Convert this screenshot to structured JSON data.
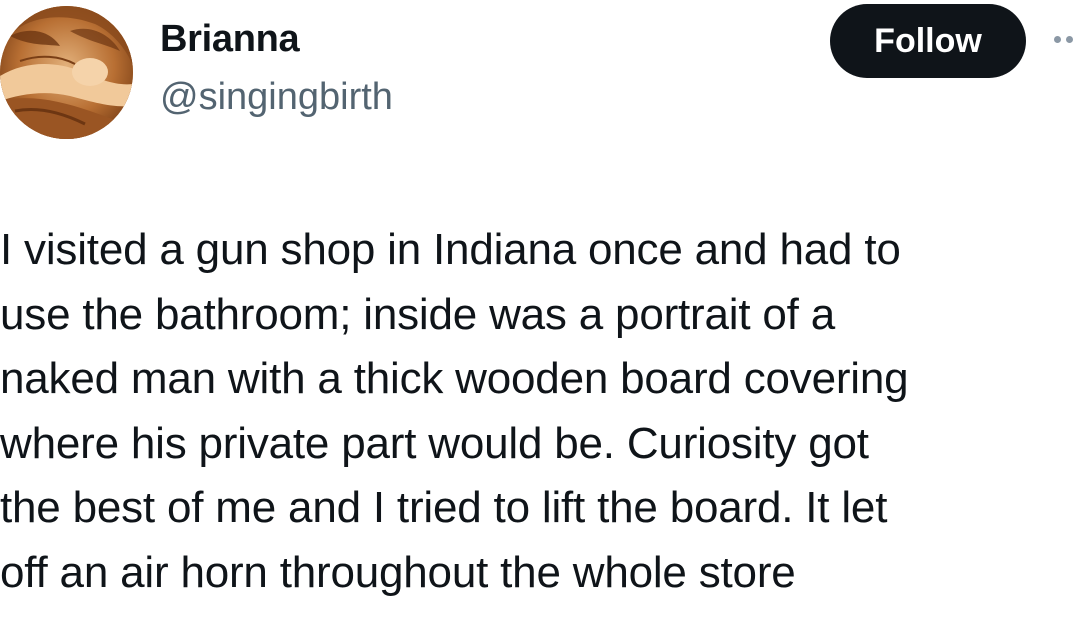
{
  "author": {
    "display_name": "Brianna",
    "handle": "@singingbirth",
    "avatar_icon": "avatar-illustration"
  },
  "actions": {
    "follow_label": "Follow",
    "more_icon": "more-options-icon"
  },
  "tweet": {
    "lines": [
      "I visited a gun shop in Indiana once and had to",
      "use the bathroom; inside was a portrait of a",
      "naked man with a thick wooden board covering",
      "where his private part would be. Curiosity got",
      "the best of me and I tried to lift the board. It let",
      "off an air horn throughout the whole store"
    ]
  },
  "colors": {
    "text": "#0f1419",
    "secondary_text": "#536471",
    "button_bg": "#0f1419",
    "button_text": "#ffffff",
    "avatar_tone": "#b9773a"
  }
}
